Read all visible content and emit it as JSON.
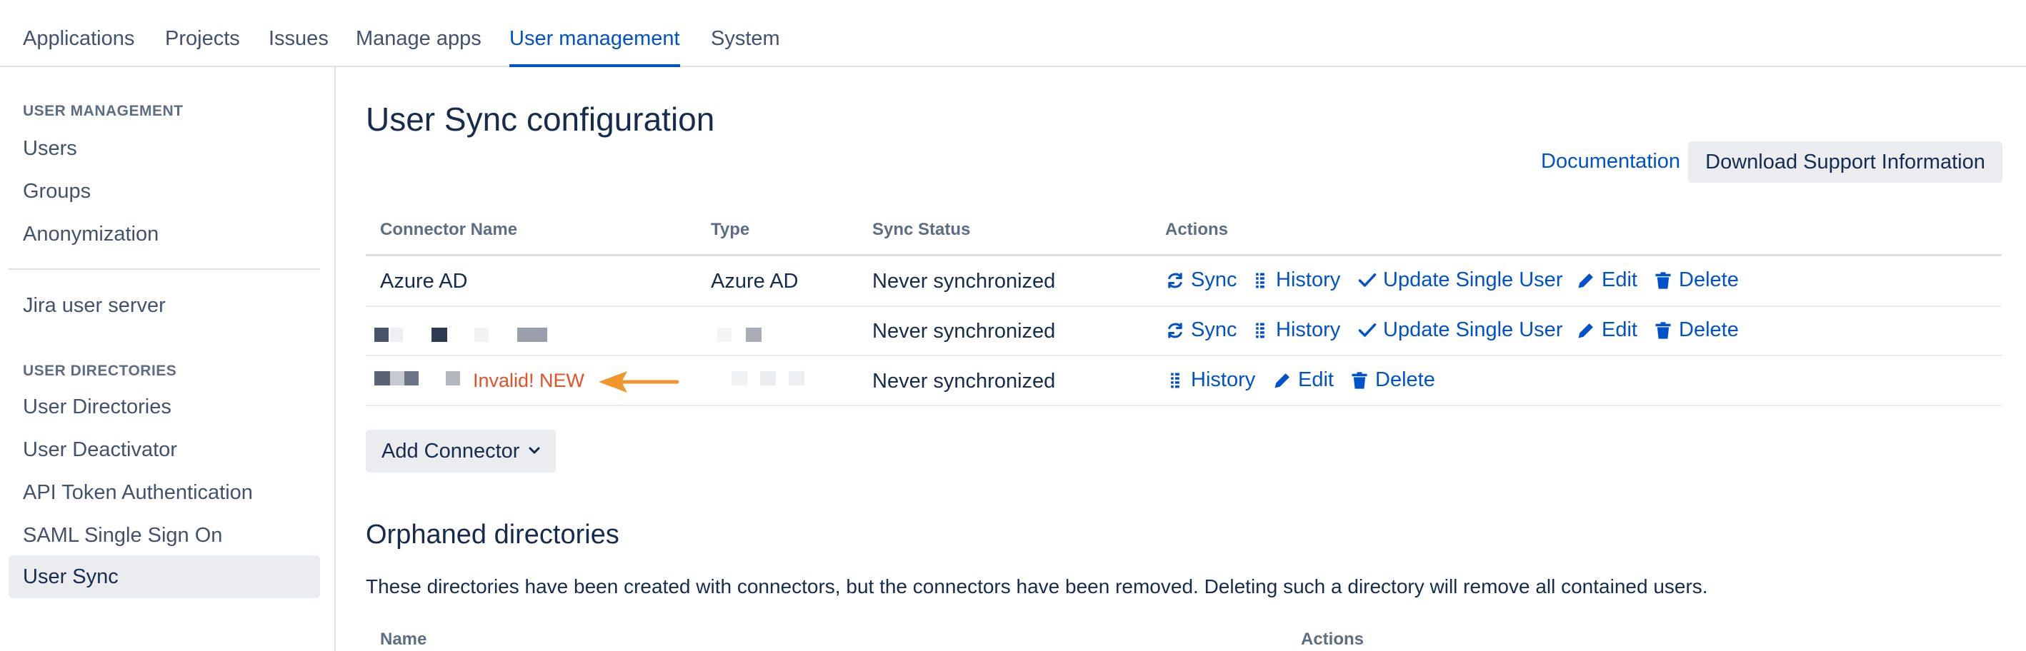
{
  "nav": {
    "tabs": [
      {
        "label": "Applications"
      },
      {
        "label": "Projects"
      },
      {
        "label": "Issues"
      },
      {
        "label": "Manage apps"
      },
      {
        "label": "User management",
        "active": true
      },
      {
        "label": "System"
      }
    ]
  },
  "sidebar": {
    "heading_user_management": "USER MANAGEMENT",
    "items_user": [
      "Users",
      "Groups",
      "Anonymization"
    ],
    "jira_user_server": "Jira user server",
    "heading_user_directories": "USER DIRECTORIES",
    "items_directories": [
      "User Directories",
      "User Deactivator",
      "API Token Authentication",
      "SAML Single Sign On",
      "User Sync"
    ],
    "selected": "User Sync"
  },
  "page": {
    "title": "User Sync configuration",
    "documentation_link": "Documentation",
    "download_support_button": "Download Support Information"
  },
  "connectors_table": {
    "headers": {
      "name": "Connector Name",
      "type": "Type",
      "status": "Sync Status",
      "actions": "Actions"
    },
    "rows": [
      {
        "name": "Azure AD",
        "type": "Azure AD",
        "status": "Never synchronized",
        "actions": {
          "sync": "Sync",
          "history": "History",
          "update_single_user": "Update Single User",
          "edit": "Edit",
          "delete": "Delete"
        }
      },
      {
        "name": "",
        "type": "",
        "status": "Never synchronized",
        "actions": {
          "sync": "Sync",
          "history": "History",
          "update_single_user": "Update Single User",
          "edit": "Edit",
          "delete": "Delete"
        }
      },
      {
        "name": "",
        "badge": "Invalid! NEW",
        "type": "",
        "status": "Never synchronized",
        "actions": {
          "history": "History",
          "edit": "Edit",
          "delete": "Delete"
        }
      }
    ]
  },
  "add_connector_button": "Add Connector",
  "orphaned": {
    "title": "Orphaned directories",
    "description": "These directories have been created with connectors, but the connectors have been removed. Deleting such a directory will remove all contained users.",
    "headers": {
      "name": "Name",
      "actions": "Actions"
    }
  },
  "icons": {
    "sync": "sync-icon",
    "history": "history-list-icon",
    "update": "checkmark-icon",
    "edit": "pencil-icon",
    "delete": "trash-icon",
    "chevron": "chevron-down-icon",
    "annotation": "arrow-left-icon"
  },
  "colors": {
    "link": "#0052cc",
    "invalid": "#e65124",
    "annotation_arrow": "#f0952b",
    "selected_bg": "#ebecf0"
  }
}
